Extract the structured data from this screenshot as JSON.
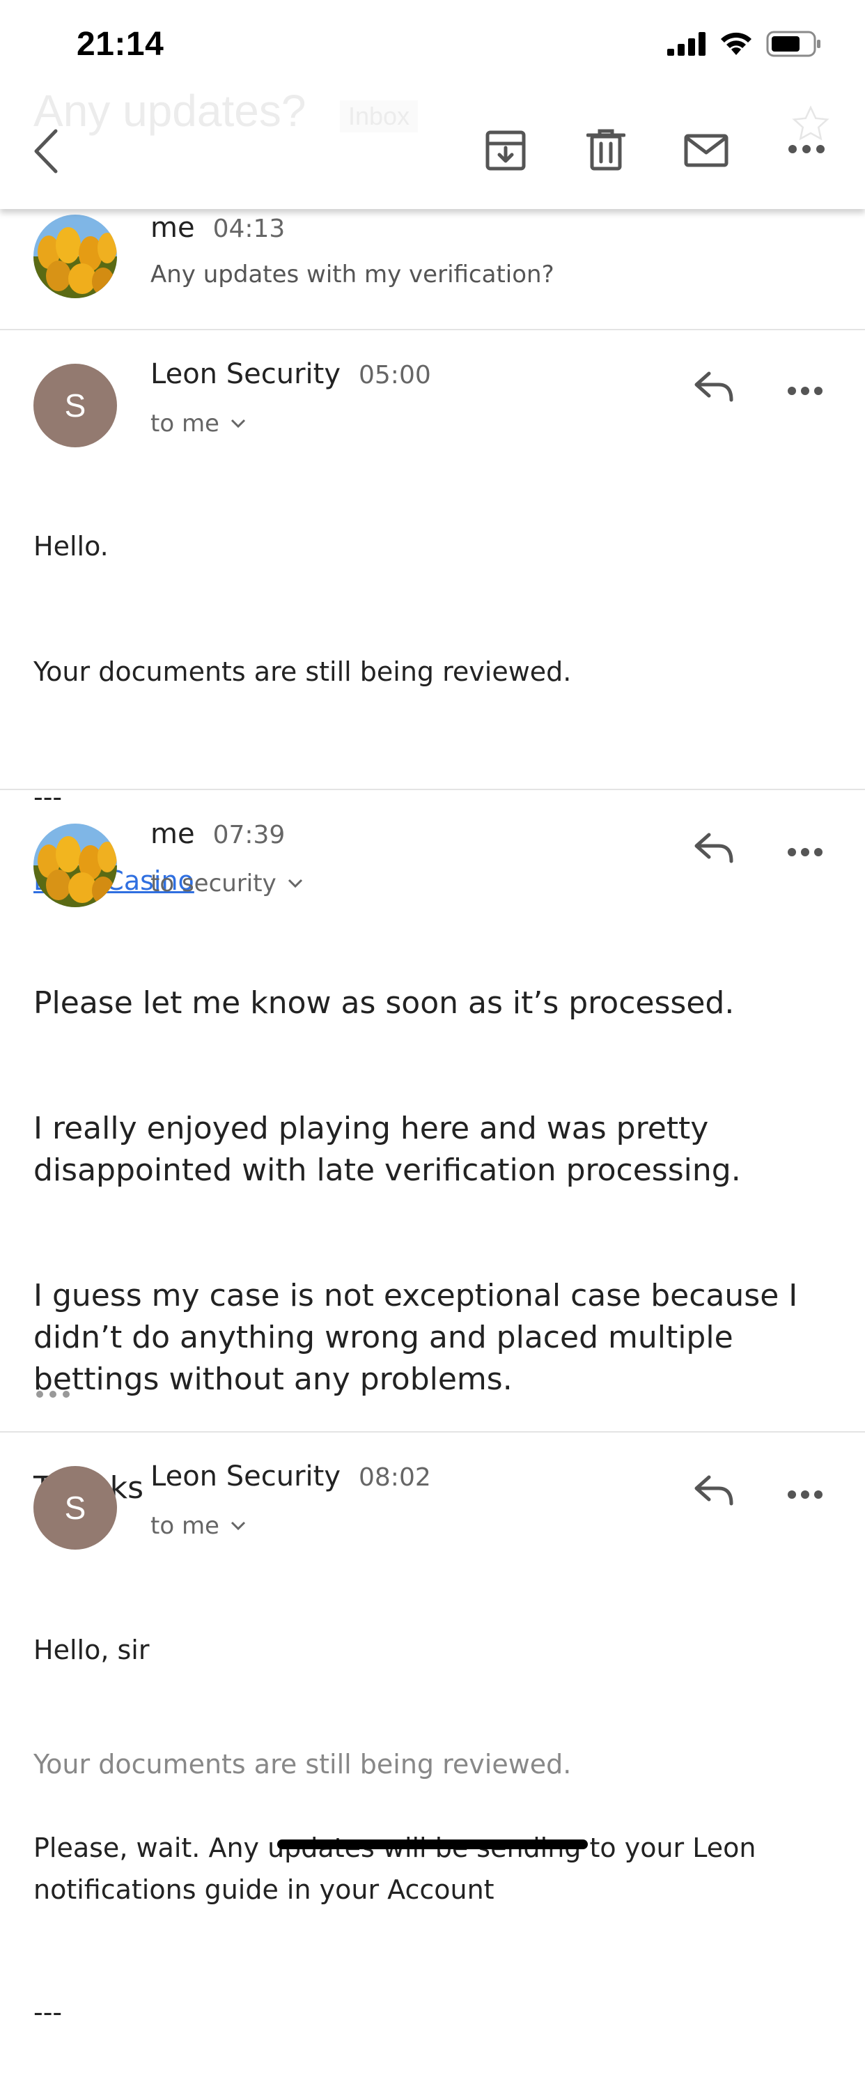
{
  "status_bar": {
    "time": "21:14"
  },
  "header": {
    "subject": "Any updates?",
    "label": "Inbox",
    "icons": [
      "back-icon",
      "archive-icon",
      "trash-icon",
      "mail-icon",
      "more-icon",
      "star-icon"
    ]
  },
  "messages": [
    {
      "sender": "me",
      "time": "04:13",
      "snippet": "Any updates with my verification?",
      "avatar": "tulip-photo"
    },
    {
      "sender": "Leon Security",
      "time": "05:00",
      "recipient": "to me",
      "avatar_letter": "S",
      "body": {
        "greeting": "Hello.",
        "line1": "Your documents are still being reviewed.",
        "separator": "---",
        "signature_link": "Leon Casino"
      }
    },
    {
      "sender": "me",
      "time": "07:39",
      "recipient": "to security",
      "avatar": "tulip-photo",
      "body": {
        "p1": "Please let me know as soon as it’s processed.",
        "p2": "I really enjoyed playing here and was pretty\ndisappointed with late verification processing.",
        "p3": "I guess my case is not exceptional case because I\ndidn’t do anything wrong and placed multiple\nbettings without any problems.",
        "p4": "Thanks"
      }
    },
    {
      "sender": "Leon Security",
      "time": "08:02",
      "recipient": "to me",
      "avatar_letter": "S",
      "body": {
        "greeting": "Hello, sir",
        "quoted": "Your documents are still being reviewed.",
        "p2": "Please, wait. Any updates will be sending to your Leon\nnotifications guide in your Account",
        "separator": "---"
      }
    }
  ],
  "colors": {
    "avatar_s": "#937a70",
    "link": "#2f6fe0",
    "icon": "#5f5f5f"
  }
}
